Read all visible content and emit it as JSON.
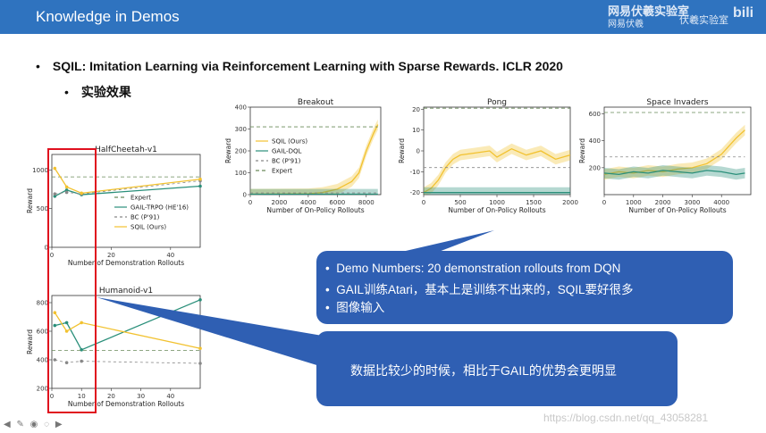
{
  "header": {
    "title": "Knowledge in Demos",
    "logo_main": "网易伏羲实验室",
    "logo_sub": "网易伏羲",
    "logo_lab": "伏羲实验室",
    "bili": "bili"
  },
  "bullets": {
    "paper": "SQIL: Imitation Learning via Reinforcement Learning with Sparse Rewards. ICLR 2020",
    "sub": "实验效果",
    "dot": "•"
  },
  "callout1": {
    "items": [
      "Demo Numbers:  20 demonstration rollouts from DQN",
      "GAIL训练Atari，基本上是训练不出来的，SQIL要好很多",
      "图像输入"
    ]
  },
  "callout2": {
    "text": "数据比较少的时候，相比于GAIL的优势会更明显"
  },
  "watermark": "https://blog.csdn.net/qq_43058281",
  "toolbar": "◀ ✎ ◉ ◌ ▶",
  "colors": {
    "header": "#2f73bf",
    "callout": "#2f5fb3",
    "sqil": "#f2c230",
    "gail": "#2a8f7a",
    "bc": "#888888",
    "expert": "#6a8a5a",
    "redbox": "#e0101e"
  },
  "chart_data": [
    {
      "type": "line",
      "title": "Breakout",
      "xlabel": "Number of On-Policy Rollouts",
      "ylabel": "Reward",
      "xlim": [
        0,
        9000
      ],
      "ylim": [
        0,
        400
      ],
      "xticks": [
        "0",
        "2000",
        "4000",
        "6000",
        "8000"
      ],
      "yticks": [
        "0",
        "100",
        "200",
        "300",
        "400"
      ],
      "legend": [
        "SQIL (Ours)",
        "GAIL-DQL",
        "BC (P'91)",
        "Expert"
      ],
      "series": [
        {
          "name": "SQIL (Ours)",
          "x": [
            0,
            2000,
            4000,
            5000,
            6000,
            7000,
            7500,
            8000,
            8500,
            8800
          ],
          "y": [
            2,
            3,
            4,
            10,
            25,
            60,
            100,
            200,
            280,
            320
          ]
        },
        {
          "name": "GAIL-DQL",
          "x": [
            0,
            8800
          ],
          "y": [
            2,
            2
          ]
        },
        {
          "name": "BC (P'91)",
          "x": [
            0,
            8800
          ],
          "y": [
            8,
            8
          ]
        },
        {
          "name": "Expert",
          "x": [
            0,
            8800
          ],
          "y": [
            310,
            310
          ]
        }
      ]
    },
    {
      "type": "line",
      "title": "Pong",
      "xlabel": "Number of On-Policy Rollouts",
      "ylabel": "Reward",
      "xlim": [
        0,
        2000
      ],
      "ylim": [
        -21,
        21
      ],
      "xticks": [
        "0",
        "500",
        "1000",
        "1500",
        "2000"
      ],
      "yticks": [
        "-20",
        "-10",
        "0",
        "10",
        "20"
      ],
      "series": [
        {
          "name": "SQIL (Ours)",
          "x": [
            0,
            100,
            200,
            300,
            400,
            500,
            700,
            900,
            1000,
            1200,
            1400,
            1600,
            1800,
            2000
          ],
          "y": [
            -20,
            -18,
            -14,
            -8,
            -4,
            -2,
            -1,
            0,
            -3,
            1,
            -2,
            0,
            -4,
            -2
          ]
        },
        {
          "name": "GAIL-DQL",
          "x": [
            0,
            500,
            1000,
            1500,
            2000
          ],
          "y": [
            -20,
            -20,
            -20,
            -20,
            -20
          ]
        },
        {
          "name": "BC (P'91)",
          "x": [
            0,
            2000
          ],
          "y": [
            -8,
            -8
          ]
        },
        {
          "name": "Expert",
          "x": [
            0,
            2000
          ],
          "y": [
            20.5,
            20.5
          ]
        }
      ]
    },
    {
      "type": "line",
      "title": "Space Invaders",
      "xlabel": "Number of On-Policy Rollouts",
      "ylabel": "Reward",
      "xlim": [
        0,
        5000
      ],
      "ylim": [
        0,
        650
      ],
      "xticks": [
        "0",
        "1000",
        "2000",
        "3000",
        "4000"
      ],
      "yticks": [
        "200",
        "400",
        "600"
      ],
      "series": [
        {
          "name": "SQIL (Ours)",
          "x": [
            0,
            500,
            1000,
            1500,
            2000,
            2500,
            3000,
            3500,
            4000,
            4500,
            4800
          ],
          "y": [
            150,
            170,
            160,
            180,
            170,
            190,
            200,
            230,
            300,
            420,
            480
          ]
        },
        {
          "name": "GAIL-DQL",
          "x": [
            0,
            500,
            1000,
            1500,
            2000,
            2500,
            3000,
            3500,
            4000,
            4500,
            4800
          ],
          "y": [
            160,
            150,
            170,
            160,
            180,
            170,
            160,
            180,
            170,
            150,
            160
          ]
        },
        {
          "name": "BC (P'91)",
          "x": [
            0,
            4800
          ],
          "y": [
            280,
            280
          ]
        },
        {
          "name": "Expert",
          "x": [
            0,
            4800
          ],
          "y": [
            610,
            610
          ]
        }
      ]
    },
    {
      "type": "line",
      "title": "HalfCheetah-v1",
      "xlabel": "Number of Demonstration Rollouts",
      "ylabel": "Reward",
      "xlim": [
        0,
        50
      ],
      "ylim": [
        0,
        1200
      ],
      "xticks": [
        "0",
        "20",
        "40"
      ],
      "yticks": [
        "0",
        "500",
        "1000"
      ],
      "legend": [
        "Expert",
        "GAIL-TRPO (HE'16)",
        "BC (P'91)",
        "SQIL (Ours)"
      ],
      "series": [
        {
          "name": "Expert",
          "x": [
            0,
            50
          ],
          "y": [
            910,
            910
          ]
        },
        {
          "name": "GAIL-TRPO (HE'16)",
          "x": [
            1,
            5,
            10,
            50
          ],
          "y": [
            660,
            740,
            680,
            790
          ]
        },
        {
          "name": "BC (P'91)",
          "x": [
            1,
            5,
            10,
            50
          ],
          "y": [
            690,
            710,
            690,
            860
          ]
        },
        {
          "name": "SQIL (Ours)",
          "x": [
            1,
            5,
            10,
            50
          ],
          "y": [
            1020,
            780,
            700,
            880
          ]
        }
      ]
    },
    {
      "type": "line",
      "title": "Humanoid-v1",
      "xlabel": "Number of Demonstration Rollouts",
      "ylabel": "Reward",
      "xlim": [
        0,
        50
      ],
      "ylim": [
        200,
        850
      ],
      "xticks": [
        "0",
        "10",
        "20",
        "30",
        "40"
      ],
      "yticks": [
        "200",
        "400",
        "600",
        "800"
      ],
      "series": [
        {
          "name": "GAIL-TRPO (HE'16)",
          "x": [
            1,
            5,
            10,
            50
          ],
          "y": [
            640,
            660,
            470,
            820
          ]
        },
        {
          "name": "BC (P'91)",
          "x": [
            1,
            5,
            10,
            50
          ],
          "y": [
            400,
            380,
            390,
            375
          ]
        },
        {
          "name": "SQIL (Ours)",
          "x": [
            1,
            5,
            10,
            50
          ],
          "y": [
            730,
            600,
            660,
            480
          ]
        },
        {
          "name": "Expert",
          "x": [
            0,
            50
          ],
          "y": [
            465,
            465
          ]
        }
      ]
    }
  ]
}
